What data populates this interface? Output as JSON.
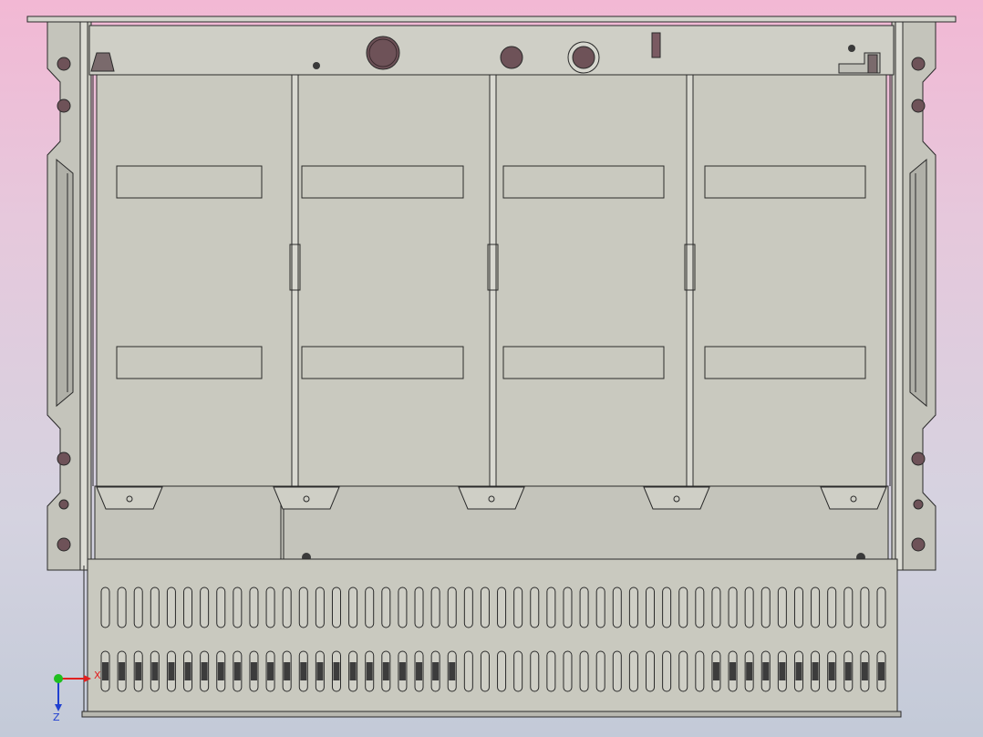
{
  "viewport": {
    "model": "sheet-metal-chassis-assembly",
    "bays": 4,
    "vent_slots_per_row": 48,
    "colors": {
      "background_top": "#f2b8d4",
      "background_bottom": "#c3cad8",
      "panel_face": "#c9c9bf",
      "panel_shade": "#b6b6ad",
      "edge": "#2a2a2a",
      "hole_fill": "#6e5258",
      "slot_dark": "#3c3c3c"
    }
  },
  "triad": {
    "x_label": "X",
    "z_label": "Z",
    "x_color": "#e02020",
    "y_color": "#1fbf1f",
    "z_color": "#2040d0"
  }
}
